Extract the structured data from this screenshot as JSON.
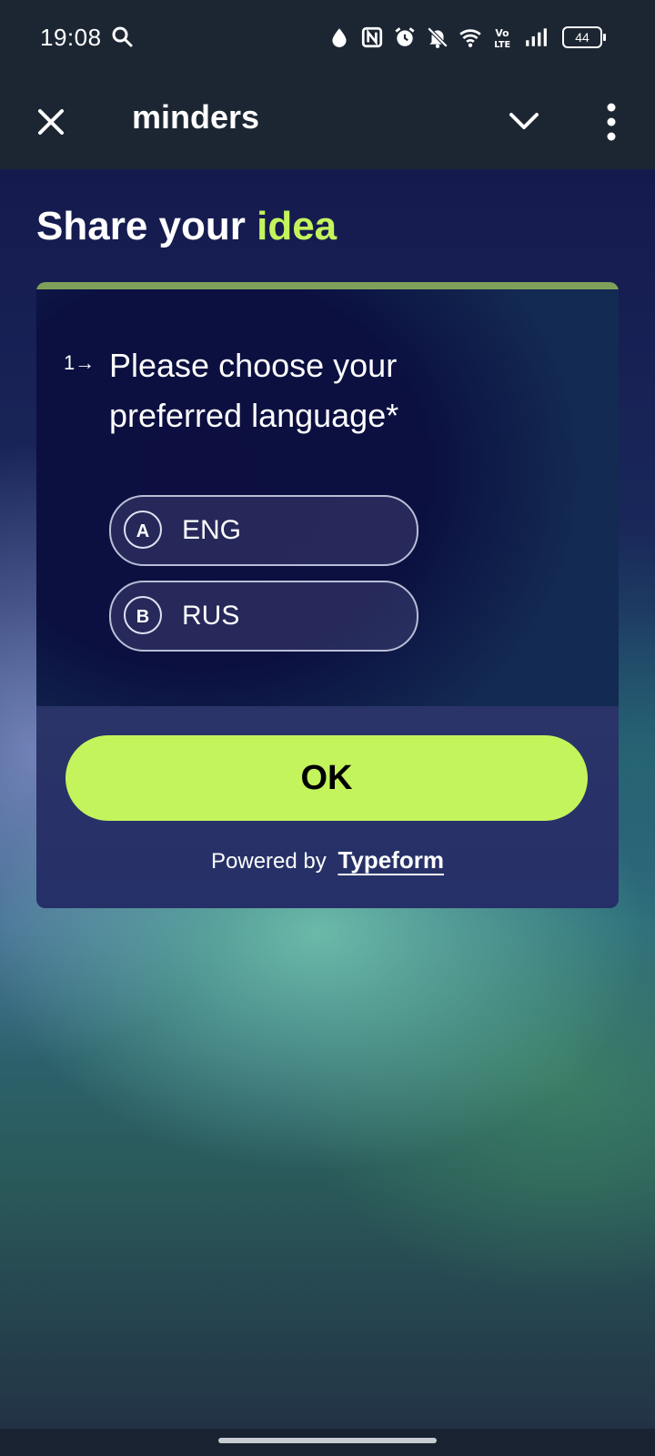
{
  "status_bar": {
    "time": "19:08",
    "battery": "44",
    "icons": [
      "search-icon",
      "water-drop-icon",
      "nfc-icon",
      "alarm-icon",
      "notifications-off-icon",
      "wifi-icon",
      "volte-icon",
      "signal-icon",
      "battery-icon"
    ]
  },
  "app_bar": {
    "title": "minders",
    "icons": [
      "close-icon",
      "chevron-down-icon",
      "more-vertical-icon"
    ]
  },
  "form": {
    "heading_prefix": "Share your ",
    "heading_accent": "idea",
    "question_number": "1→",
    "question_text": "Please choose your preferred language*",
    "choices": [
      {
        "key": "A",
        "label": "ENG"
      },
      {
        "key": "B",
        "label": "RUS"
      }
    ],
    "submit_label": "OK",
    "powered_by": "Powered by",
    "brand": "Typeform"
  },
  "colors": {
    "accent": "#c3f45c",
    "card": "#232959",
    "bars": "#1c2633"
  }
}
